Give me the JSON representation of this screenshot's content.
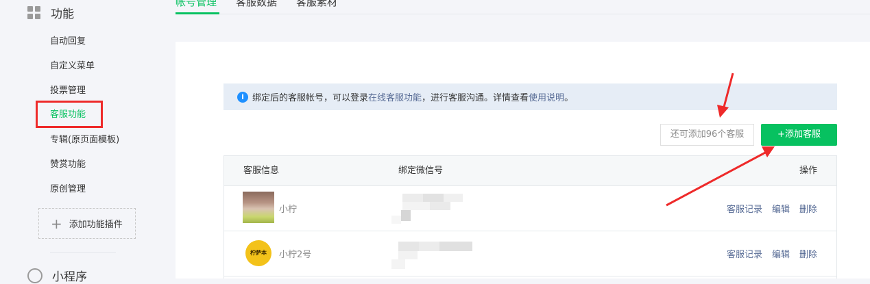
{
  "sidebar": {
    "section_title": "功能",
    "section_icon": "grid-icon",
    "items": [
      {
        "label": "自动回复"
      },
      {
        "label": "自定义菜单"
      },
      {
        "label": "投票管理"
      },
      {
        "label": "客服功能"
      },
      {
        "label": "专辑(原页面模板)"
      },
      {
        "label": "赞赏功能"
      },
      {
        "label": "原创管理"
      }
    ],
    "add_plugin_label": "添加功能插件",
    "next_section_title": "小程序"
  },
  "tabs": [
    {
      "label": "帐号管理",
      "active": true
    },
    {
      "label": "客服数据",
      "active": false
    },
    {
      "label": "客服素材",
      "active": false
    }
  ],
  "notice": {
    "text_before": "绑定后的客服帐号，可以登录",
    "link1": "在线客服功能",
    "text_middle": "，进行客服沟通。详情查看",
    "link2": "使用说明",
    "text_after": "。"
  },
  "toolbar": {
    "quota_text": "还可添加96个客服",
    "add_button_label": "+添加客服"
  },
  "table": {
    "headers": {
      "info": "客服信息",
      "wechat": "绑定微信号",
      "ops": "操作"
    },
    "rows": [
      {
        "name": "小柠",
        "ops": [
          "客服记录",
          "编辑",
          "删除"
        ]
      },
      {
        "name": "小柠2号",
        "avatar_text": "柠萨本",
        "ops": [
          "客服记录",
          "编辑",
          "删除"
        ]
      }
    ]
  },
  "colors": {
    "accent_green": "#07c160",
    "link_blue": "#576b95",
    "highlight_red": "#ee2a2a"
  }
}
